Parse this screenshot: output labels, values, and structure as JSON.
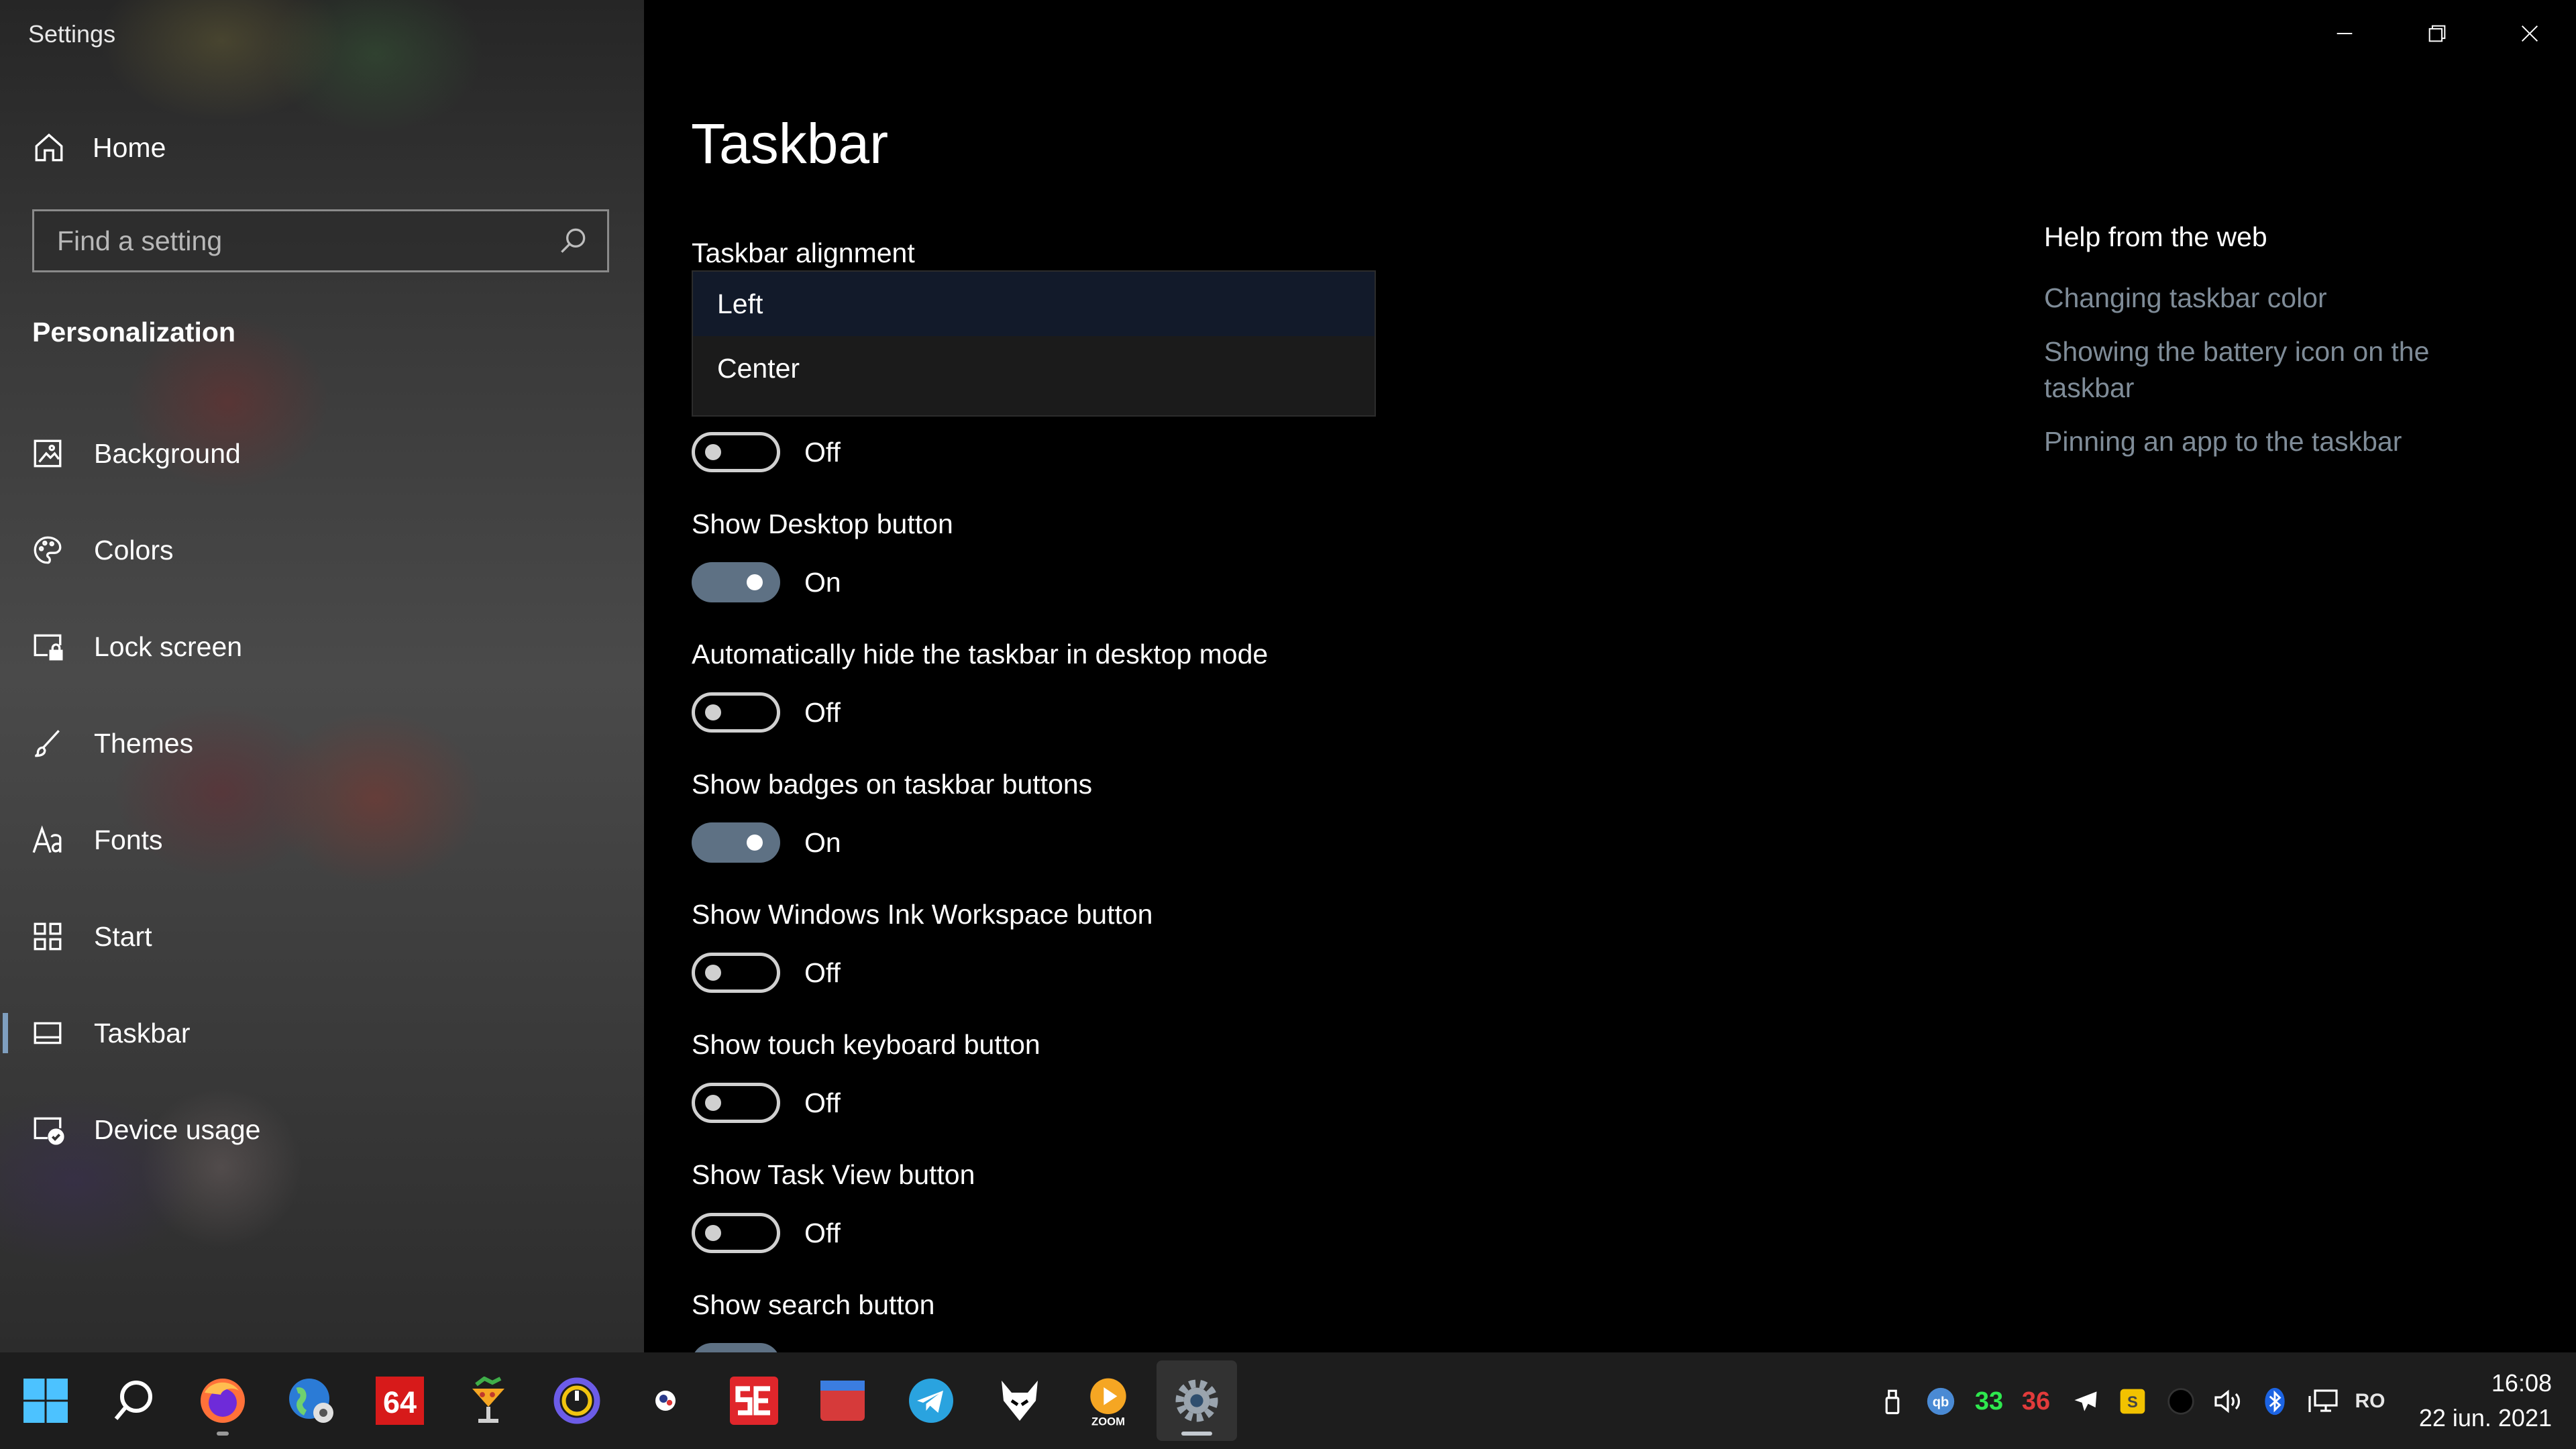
{
  "window": {
    "app_title": "Settings"
  },
  "sidebar": {
    "home_label": "Home",
    "search": {
      "placeholder": "Find a setting",
      "value": ""
    },
    "section_heading": "Personalization",
    "items": [
      {
        "label": "Background",
        "icon": "picture-icon"
      },
      {
        "label": "Colors",
        "icon": "palette-icon"
      },
      {
        "label": "Lock screen",
        "icon": "lock-screen-icon"
      },
      {
        "label": "Themes",
        "icon": "brush-icon"
      },
      {
        "label": "Fonts",
        "icon": "font-icon"
      },
      {
        "label": "Start",
        "icon": "start-grid-icon"
      },
      {
        "label": "Taskbar",
        "icon": "taskbar-icon",
        "selected": true
      },
      {
        "label": "Device usage",
        "icon": "device-usage-icon"
      }
    ]
  },
  "main": {
    "title": "Taskbar",
    "alignment": {
      "label": "Taskbar alignment",
      "options": [
        "Left",
        "Center"
      ],
      "selected": "Left"
    },
    "settings": [
      {
        "label": "",
        "state": "Off",
        "on": false
      },
      {
        "label": "Show Desktop button",
        "state": "On",
        "on": true
      },
      {
        "label": "Automatically hide the taskbar in desktop mode",
        "state": "Off",
        "on": false
      },
      {
        "label": "Show badges on taskbar buttons",
        "state": "On",
        "on": true
      },
      {
        "label": "Show Windows Ink Workspace button",
        "state": "Off",
        "on": false
      },
      {
        "label": "Show touch keyboard button",
        "state": "Off",
        "on": false
      },
      {
        "label": "Show Task View button",
        "state": "Off",
        "on": false
      },
      {
        "label": "Show search button",
        "state": "",
        "on": true
      }
    ]
  },
  "help": {
    "title": "Help from the web",
    "links": [
      "Changing taskbar color",
      "Showing the battery icon on the taskbar",
      "Pinning an app to the taskbar"
    ]
  },
  "taskbar": {
    "apps": [
      "windows-start-icon",
      "search-icon",
      "firefox-icon",
      "globe-icon",
      "aida64-icon",
      "cocktail-icon",
      "power-app-icon",
      "obs-icon",
      "se-app-icon",
      "window-app-icon",
      "telegram-icon",
      "fox-app-icon",
      "zoom-icon",
      "settings-gear-icon"
    ],
    "zoom_label": "ZOOM",
    "aida_label": "64",
    "tray": {
      "temp_green": "33",
      "temp_red": "36",
      "keyboard_layout": "RO"
    },
    "clock": {
      "time": "16:08",
      "date": "22 iun. 2021"
    }
  },
  "colors": {
    "accent_toggle": "#5e7184",
    "help_link": "#7f8c98",
    "taskbar_bg": "#1d1d1d"
  }
}
